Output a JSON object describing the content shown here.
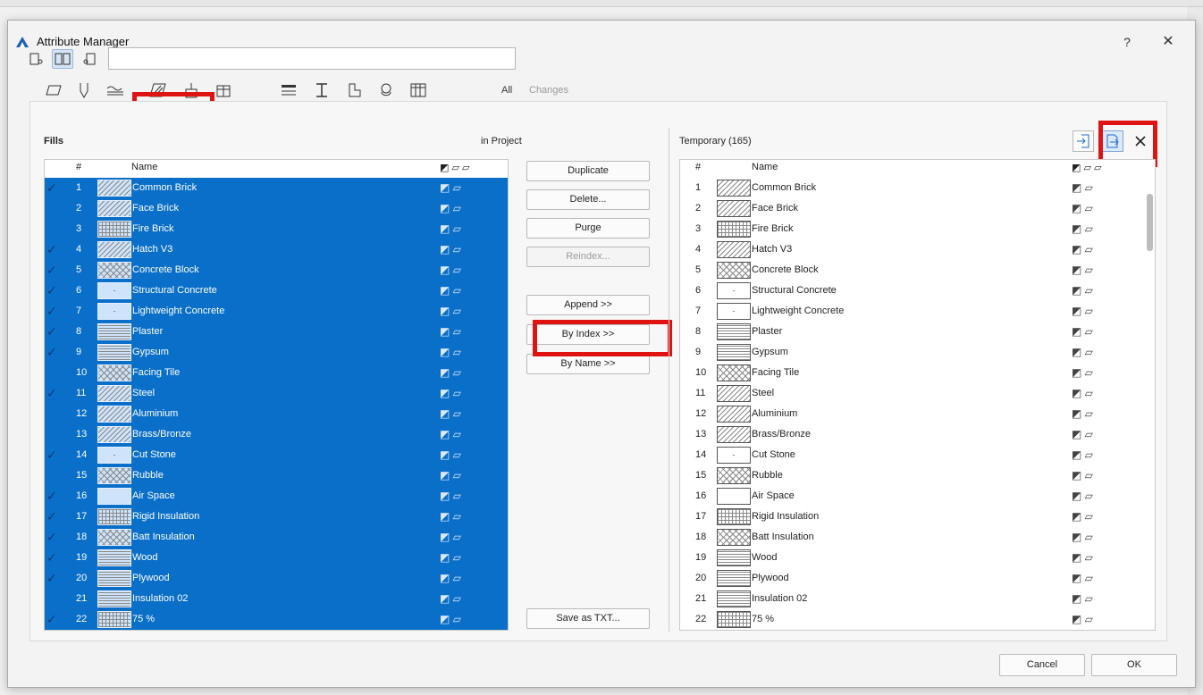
{
  "window": {
    "title": "Attribute Manager",
    "help": "?",
    "close": "✕"
  },
  "search": {
    "value": ""
  },
  "type_tabs": {
    "all": "All",
    "changes": "Changes"
  },
  "left": {
    "label": "Fills",
    "location": "in Project",
    "col_num": "#",
    "col_name": "Name",
    "rows": [
      {
        "num": "1",
        "name": "Common Brick",
        "check": true
      },
      {
        "num": "2",
        "name": "Face Brick",
        "check": false
      },
      {
        "num": "3",
        "name": "Fire Brick",
        "check": false
      },
      {
        "num": "4",
        "name": "Hatch V3",
        "check": true
      },
      {
        "num": "5",
        "name": "Concrete Block",
        "check": true
      },
      {
        "num": "6",
        "name": "Structural Concrete",
        "check": true
      },
      {
        "num": "7",
        "name": "Lightweight Concrete",
        "check": true
      },
      {
        "num": "8",
        "name": "Plaster",
        "check": true
      },
      {
        "num": "9",
        "name": "Gypsum",
        "check": true
      },
      {
        "num": "10",
        "name": "Facing Tile",
        "check": false
      },
      {
        "num": "11",
        "name": "Steel",
        "check": true
      },
      {
        "num": "12",
        "name": "Aluminium",
        "check": false
      },
      {
        "num": "13",
        "name": "Brass/Bronze",
        "check": false
      },
      {
        "num": "14",
        "name": "Cut Stone",
        "check": true
      },
      {
        "num": "15",
        "name": "Rubble",
        "check": false
      },
      {
        "num": "16",
        "name": "Air Space",
        "check": true
      },
      {
        "num": "17",
        "name": "Rigid Insulation",
        "check": true
      },
      {
        "num": "18",
        "name": "Batt Insulation",
        "check": true
      },
      {
        "num": "19",
        "name": "Wood",
        "check": true
      },
      {
        "num": "20",
        "name": "Plywood",
        "check": true
      },
      {
        "num": "21",
        "name": "Insulation 02",
        "check": false
      },
      {
        "num": "22",
        "name": "75 %",
        "check": true
      }
    ]
  },
  "middle": {
    "duplicate": "Duplicate",
    "delete": "Delete...",
    "purge": "Purge",
    "reindex": "Reindex...",
    "append": "Append >>",
    "by_index": "By Index >>",
    "by_name": "By Name >>",
    "save_txt": "Save as TXT..."
  },
  "right": {
    "label": "Temporary (165)",
    "col_num": "#",
    "col_name": "Name",
    "rows": [
      {
        "num": "1",
        "name": "Common Brick"
      },
      {
        "num": "2",
        "name": "Face Brick"
      },
      {
        "num": "3",
        "name": "Fire Brick"
      },
      {
        "num": "4",
        "name": "Hatch V3"
      },
      {
        "num": "5",
        "name": "Concrete Block"
      },
      {
        "num": "6",
        "name": "Structural Concrete"
      },
      {
        "num": "7",
        "name": "Lightweight Concrete"
      },
      {
        "num": "8",
        "name": "Plaster"
      },
      {
        "num": "9",
        "name": "Gypsum"
      },
      {
        "num": "10",
        "name": "Facing Tile"
      },
      {
        "num": "11",
        "name": "Steel"
      },
      {
        "num": "12",
        "name": "Aluminium"
      },
      {
        "num": "13",
        "name": "Brass/Bronze"
      },
      {
        "num": "14",
        "name": "Cut Stone"
      },
      {
        "num": "15",
        "name": "Rubble"
      },
      {
        "num": "16",
        "name": "Air Space"
      },
      {
        "num": "17",
        "name": "Rigid Insulation"
      },
      {
        "num": "18",
        "name": "Batt Insulation"
      },
      {
        "num": "19",
        "name": "Wood"
      },
      {
        "num": "20",
        "name": "Plywood"
      },
      {
        "num": "21",
        "name": "Insulation 02"
      },
      {
        "num": "22",
        "name": "75 %"
      }
    ]
  },
  "footer": {
    "cancel": "Cancel",
    "ok": "OK"
  },
  "colors": {
    "selection": "#0a6fc9",
    "highlight": "#e01313"
  }
}
